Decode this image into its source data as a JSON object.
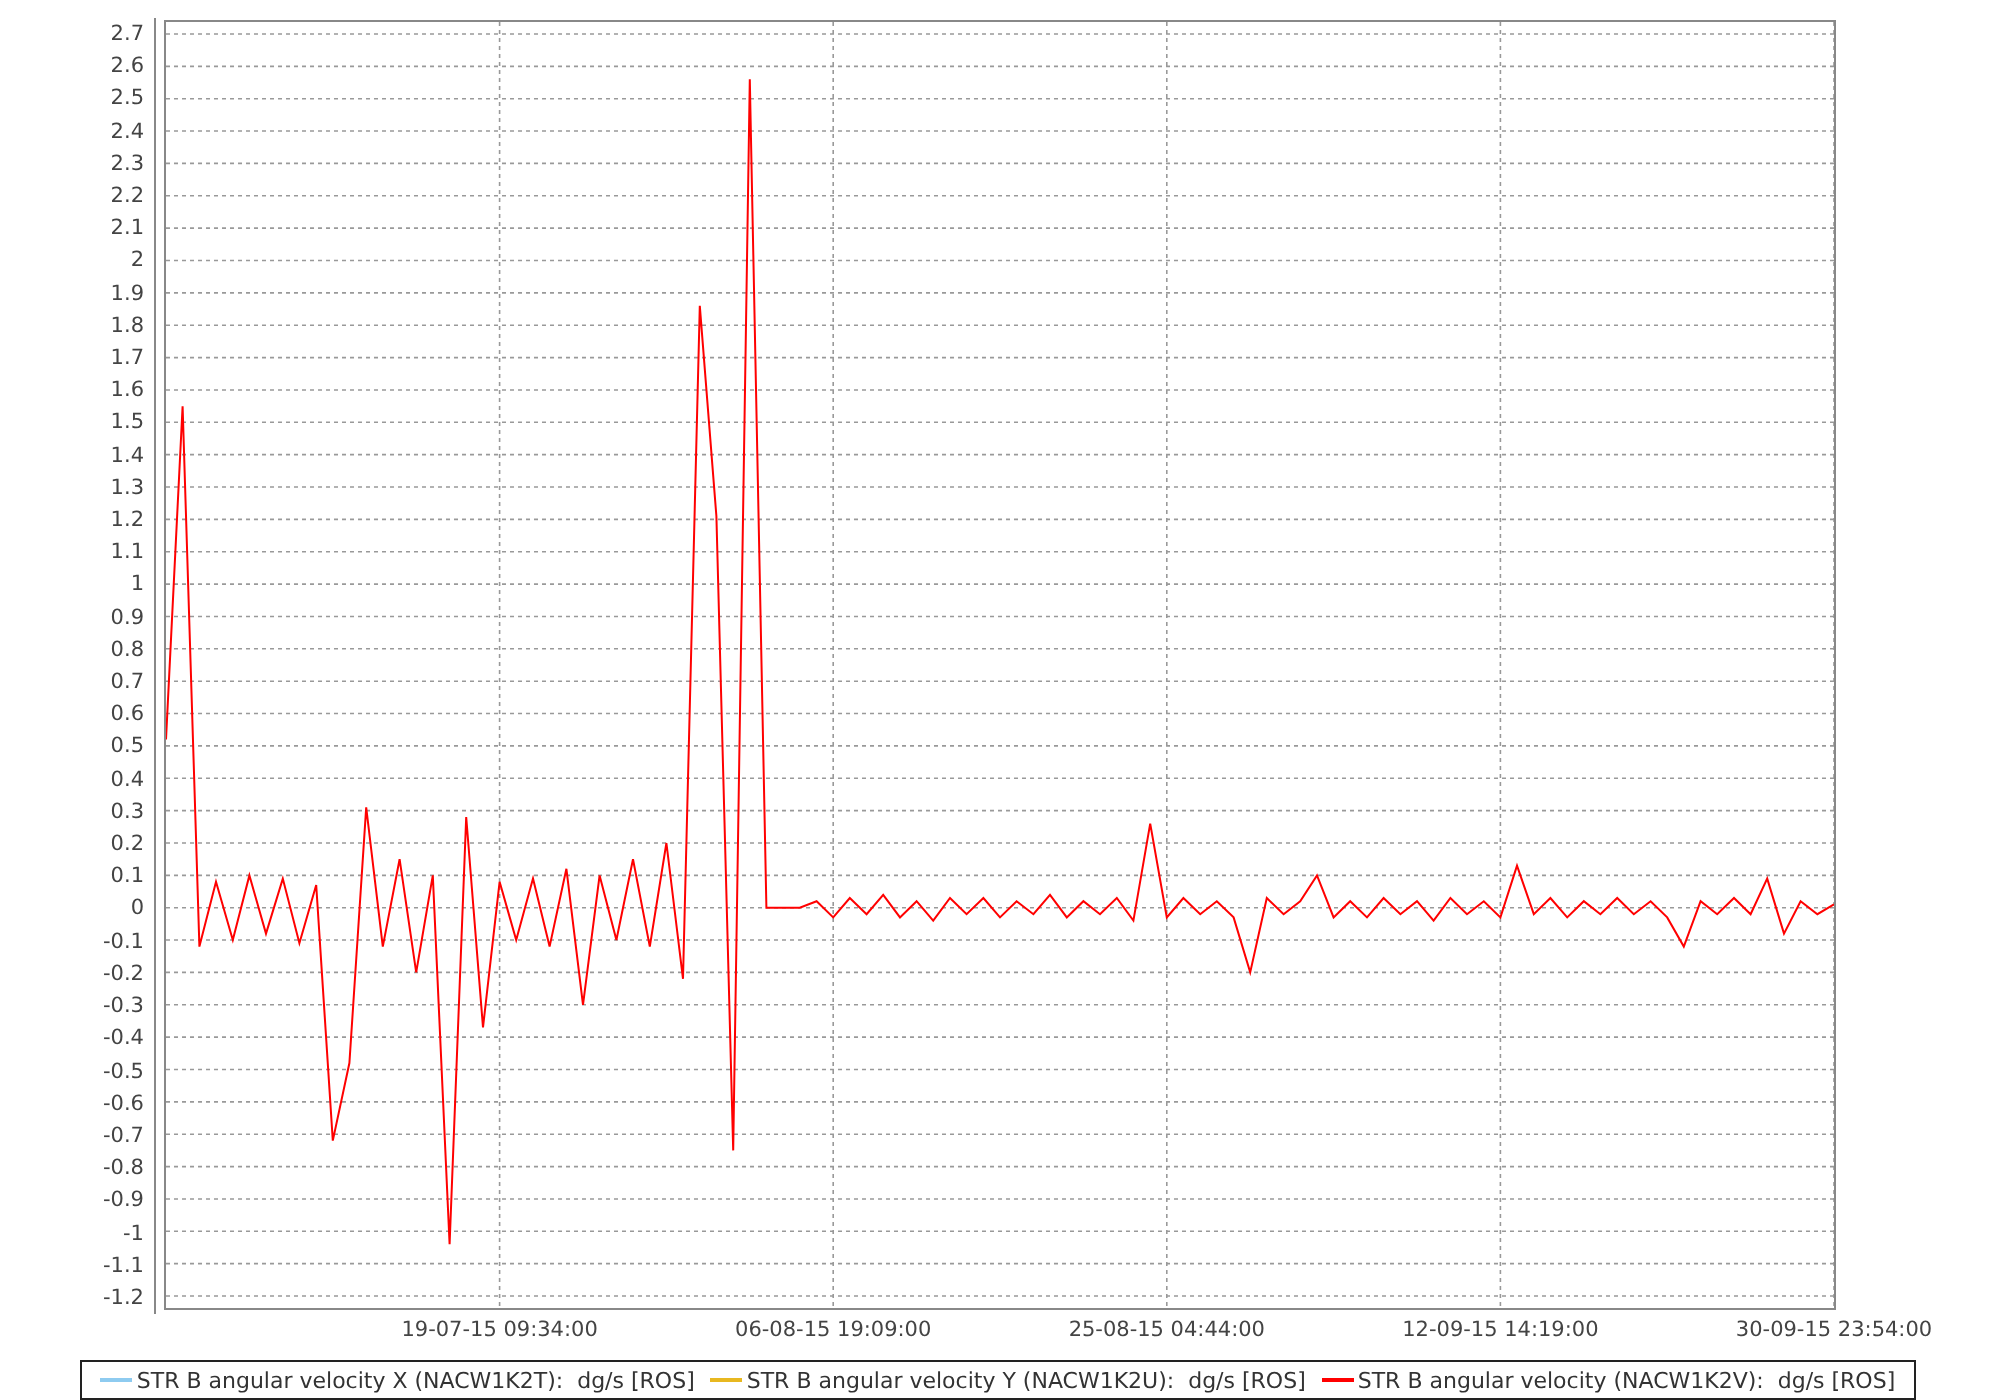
{
  "plot": {
    "chart_data": {
      "type": "line",
      "grid": true,
      "ylim": [
        -1.237,
        2.737
      ],
      "yticks": [
        2.7,
        2.6,
        2.5,
        2.4,
        2.3,
        2.2,
        2.1,
        2,
        1.9,
        1.8,
        1.7,
        1.6,
        1.5,
        1.4,
        1.3,
        1.2,
        1.1,
        1,
        0.9,
        0.8,
        0.7,
        0.6,
        0.5,
        0.4,
        0.3,
        0.2,
        0.1,
        0,
        -0.1,
        -0.2,
        -0.3,
        -0.4,
        -0.5,
        -0.6,
        -0.7,
        -0.8,
        -0.9,
        -1,
        -1.1,
        -1.2
      ],
      "categories": [
        null,
        null,
        null,
        null,
        null,
        null,
        null,
        null,
        null,
        null,
        null,
        null,
        null,
        null,
        null,
        null,
        null,
        null,
        null,
        null,
        "19-07-15 09:34:00",
        null,
        null,
        null,
        null,
        null,
        null,
        null,
        null,
        null,
        null,
        null,
        null,
        null,
        null,
        null,
        null,
        null,
        null,
        null,
        "06-08-15 19:09:00",
        null,
        null,
        null,
        null,
        null,
        null,
        null,
        null,
        null,
        null,
        null,
        null,
        null,
        null,
        null,
        null,
        null,
        null,
        null,
        "25-08-15 04:44:00",
        null,
        null,
        null,
        null,
        null,
        null,
        null,
        null,
        null,
        null,
        null,
        null,
        null,
        null,
        null,
        null,
        null,
        null,
        null,
        "12-09-15 14:19:00",
        null,
        null,
        null,
        null,
        null,
        null,
        null,
        null,
        null,
        null,
        null,
        null,
        null,
        null,
        null,
        null,
        null,
        null,
        null,
        "30-09-15 23:54:00"
      ],
      "series": [
        {
          "name": "STR B angular velocity X (NACW1K2T):  dg/s [ROS]",
          "color": "#8ecbf0",
          "values": [
            null,
            null,
            null,
            null,
            null,
            null,
            null,
            null,
            null,
            null,
            null,
            null,
            null,
            null,
            null,
            null,
            null,
            null,
            null,
            null,
            null,
            null,
            null,
            null,
            null,
            null,
            null,
            null,
            null,
            null,
            null,
            null,
            null,
            null,
            null,
            null,
            null,
            null,
            null,
            null,
            null,
            null,
            null,
            null,
            null,
            null,
            null,
            null,
            null,
            null,
            null,
            null,
            null,
            null,
            null,
            null,
            null,
            null,
            null,
            null,
            null,
            null,
            null,
            null,
            null,
            null,
            null,
            null,
            null,
            null,
            null,
            null,
            null,
            null,
            null,
            null,
            null,
            null,
            null,
            null,
            null,
            null,
            null,
            null,
            null,
            null,
            null,
            null,
            null,
            null,
            null,
            null,
            null,
            null,
            null,
            null,
            null,
            null,
            null,
            null,
            null
          ]
        },
        {
          "name": "STR B angular velocity Y (NACW1K2U):  dg/s [ROS]",
          "color": "#e8b820",
          "values": [
            null,
            null,
            null,
            null,
            null,
            null,
            null,
            null,
            null,
            null,
            null,
            null,
            null,
            null,
            null,
            null,
            null,
            null,
            null,
            null,
            null,
            null,
            null,
            null,
            null,
            null,
            null,
            null,
            null,
            null,
            null,
            null,
            null,
            null,
            null,
            null,
            null,
            null,
            null,
            null,
            null,
            null,
            null,
            null,
            null,
            null,
            null,
            null,
            null,
            null,
            null,
            null,
            null,
            null,
            null,
            null,
            null,
            null,
            null,
            null,
            null,
            null,
            null,
            null,
            null,
            null,
            null,
            null,
            null,
            null,
            null,
            null,
            null,
            null,
            null,
            null,
            null,
            null,
            null,
            null,
            null,
            null,
            null,
            null,
            null,
            null,
            null,
            null,
            null,
            null,
            null,
            null,
            null,
            null,
            null,
            null,
            null,
            null,
            null,
            null,
            null
          ]
        },
        {
          "name": "STR B angular velocity (NACW1K2V):  dg/s [ROS]",
          "color": "#ff0000",
          "values": [
            0.52,
            1.55,
            -0.12,
            0.08,
            -0.1,
            0.1,
            -0.08,
            0.09,
            -0.11,
            0.07,
            -0.72,
            -0.48,
            0.31,
            -0.12,
            0.15,
            -0.2,
            0.1,
            -1.04,
            0.28,
            -0.37,
            0.08,
            -0.1,
            0.09,
            -0.12,
            0.12,
            -0.3,
            0.1,
            -0.1,
            0.15,
            -0.12,
            0.2,
            -0.22,
            1.86,
            1.21,
            -0.75,
            2.56,
            0,
            0,
            0,
            0.02,
            -0.03,
            0.03,
            -0.02,
            0.04,
            -0.03,
            0.02,
            -0.04,
            0.03,
            -0.02,
            0.03,
            -0.03,
            0.02,
            -0.02,
            0.04,
            -0.03,
            0.02,
            -0.02,
            0.03,
            -0.04,
            0.26,
            -0.03,
            0.03,
            -0.02,
            0.02,
            -0.03,
            -0.2,
            0.03,
            -0.02,
            0.02,
            0.1,
            -0.03,
            0.02,
            -0.03,
            0.03,
            -0.02,
            0.02,
            -0.04,
            0.03,
            -0.02,
            0.02,
            -0.03,
            0.13,
            -0.02,
            0.03,
            -0.03,
            0.02,
            -0.02,
            0.03,
            -0.02,
            0.02,
            -0.03,
            -0.12,
            0.02,
            -0.02,
            0.03,
            -0.02,
            0.09,
            -0.08,
            0.02,
            -0.02,
            0.01
          ]
        }
      ]
    }
  }
}
